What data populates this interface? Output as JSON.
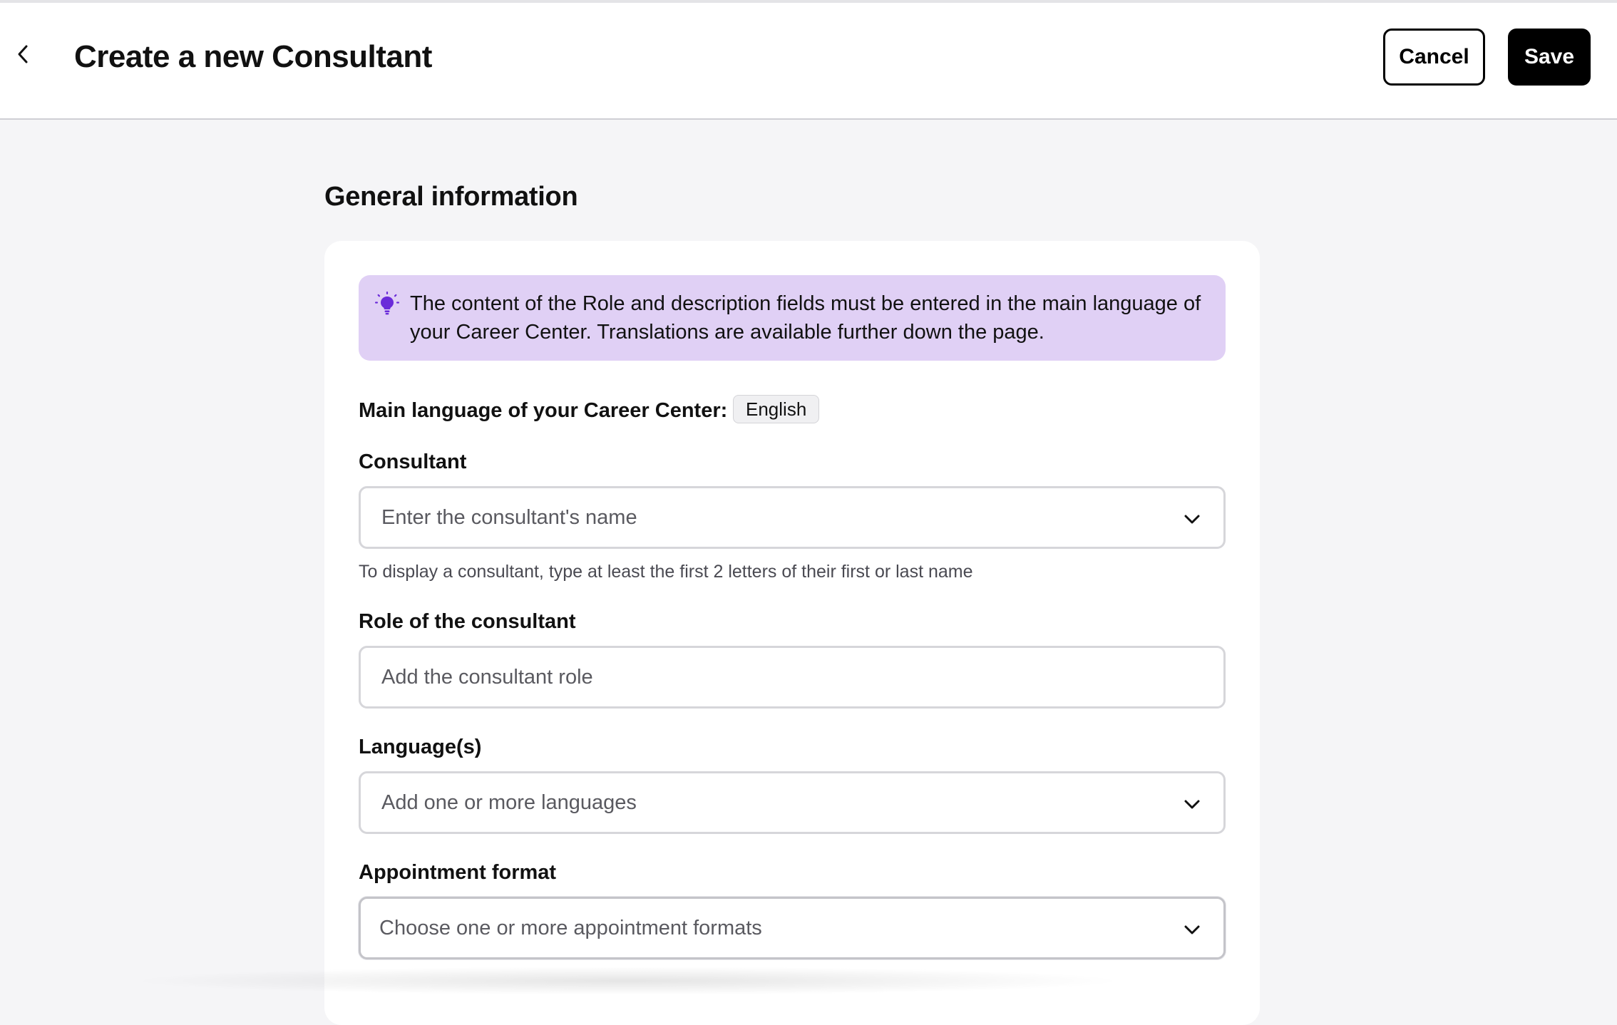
{
  "header": {
    "title": "Create a new Consultant",
    "cancel_label": "Cancel",
    "save_label": "Save"
  },
  "section": {
    "title": "General information"
  },
  "info_banner": {
    "icon": "lightbulb-icon",
    "text": "The content of the Role and description fields must be entered in the main language of your Career Center. Translations are available further down the page."
  },
  "main_language": {
    "label": "Main language of your Career Center:",
    "value": "English"
  },
  "fields": {
    "consultant": {
      "label": "Consultant",
      "placeholder": "Enter the consultant's name",
      "helper": "To display a consultant, type at least the first 2 letters of their first or last name"
    },
    "role": {
      "label": "Role of the consultant",
      "placeholder": "Add the consultant role"
    },
    "languages": {
      "label": "Language(s)",
      "placeholder": "Add one or more languages"
    },
    "appointment_format": {
      "label": "Appointment format",
      "placeholder": "Choose one or more appointment formats"
    }
  },
  "colors": {
    "banner_bg": "#e0d0f5",
    "banner_icon": "#6a2bd9",
    "primary_button": "#000000",
    "page_bg": "#f5f5f7"
  }
}
